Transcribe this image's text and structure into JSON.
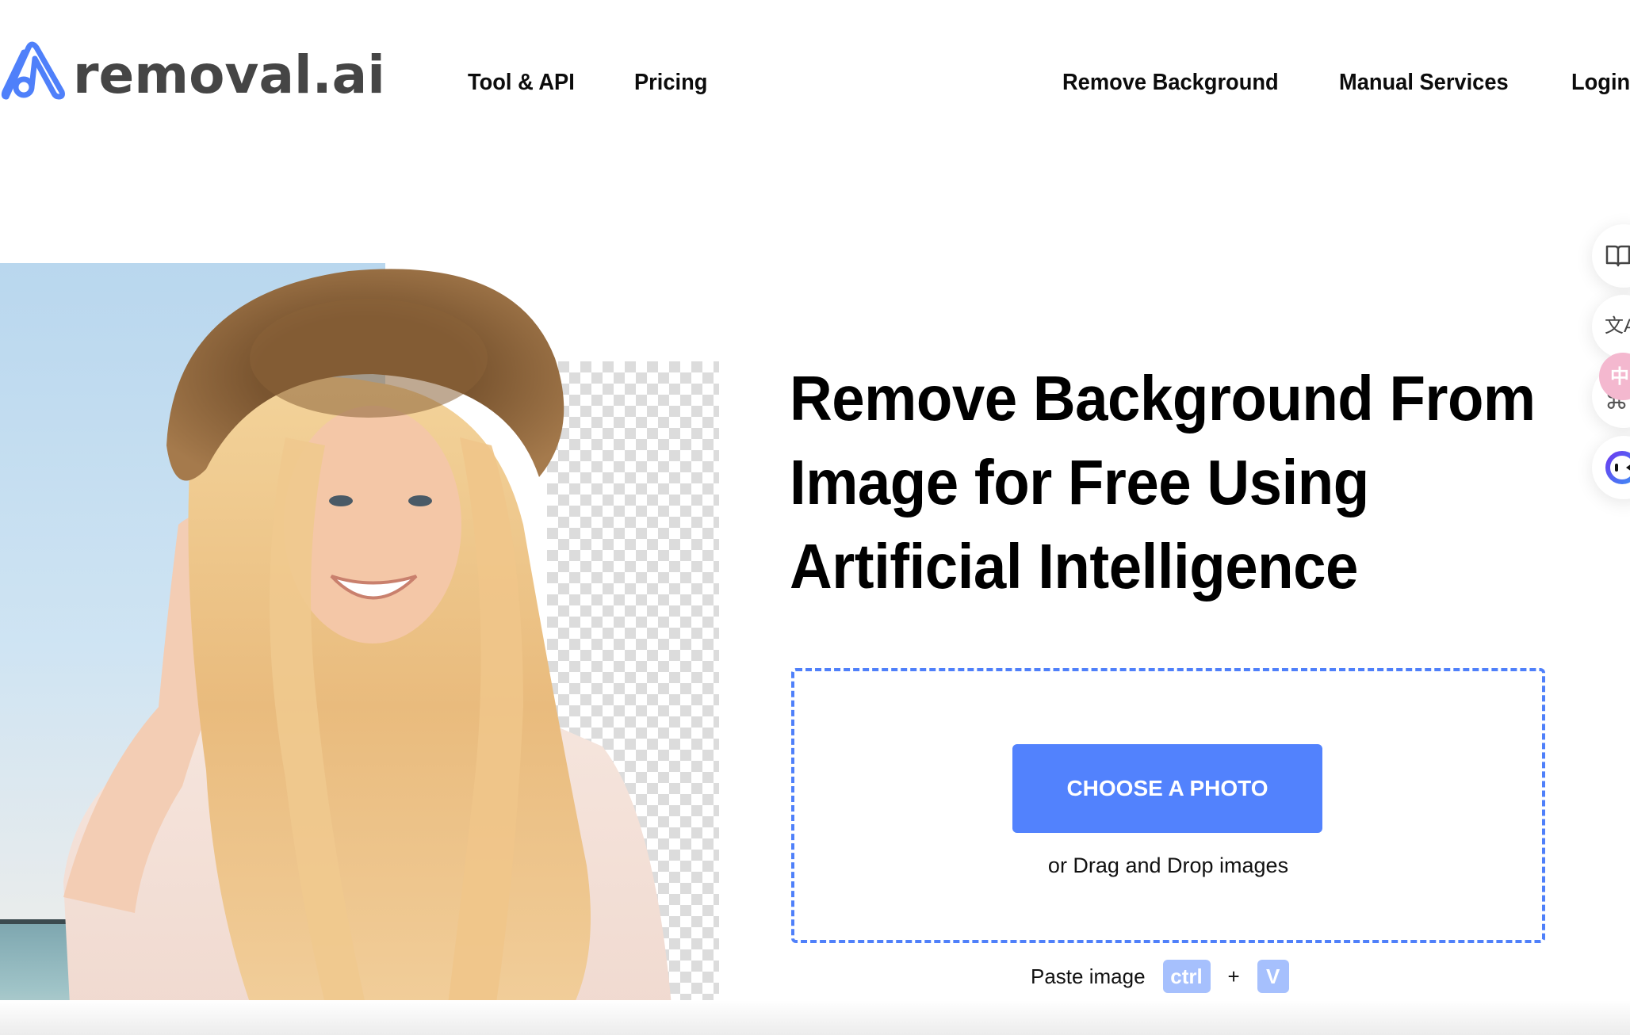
{
  "header": {
    "logo_text": "removal.ai",
    "nav_left": [
      {
        "label": "Tool & API"
      },
      {
        "label": "Pricing"
      }
    ],
    "nav_right": [
      {
        "label": "Remove Background"
      },
      {
        "label": "Manual Services"
      },
      {
        "label": "Login"
      }
    ]
  },
  "hero": {
    "headline_lines": [
      "Remove Background From",
      "Image for Free Using",
      "Artificial Intelligence"
    ],
    "image_alt": "Smiling woman in straw hat with background partially removed"
  },
  "upload": {
    "button_label": "CHOOSE A PHOTO",
    "drag_text": "or Drag and Drop images",
    "paste_label": "Paste image",
    "key_ctrl": "ctrl",
    "key_plus": "+",
    "key_v": "V"
  },
  "side_widgets": [
    {
      "icon": "book-icon",
      "glyph": "🕮"
    },
    {
      "icon": "translate-icon",
      "glyph": "文A"
    },
    {
      "icon": "command-icon",
      "glyph": "⌘",
      "badge": "中"
    },
    {
      "icon": "assistant-icon",
      "glyph": ""
    }
  ],
  "colors": {
    "brand_blue": "#5282fd",
    "dashed_border": "#4f80fa",
    "key_bg": "#a6c0fd",
    "logo_text": "#454545",
    "pink_badge": "#f4b8cf"
  }
}
